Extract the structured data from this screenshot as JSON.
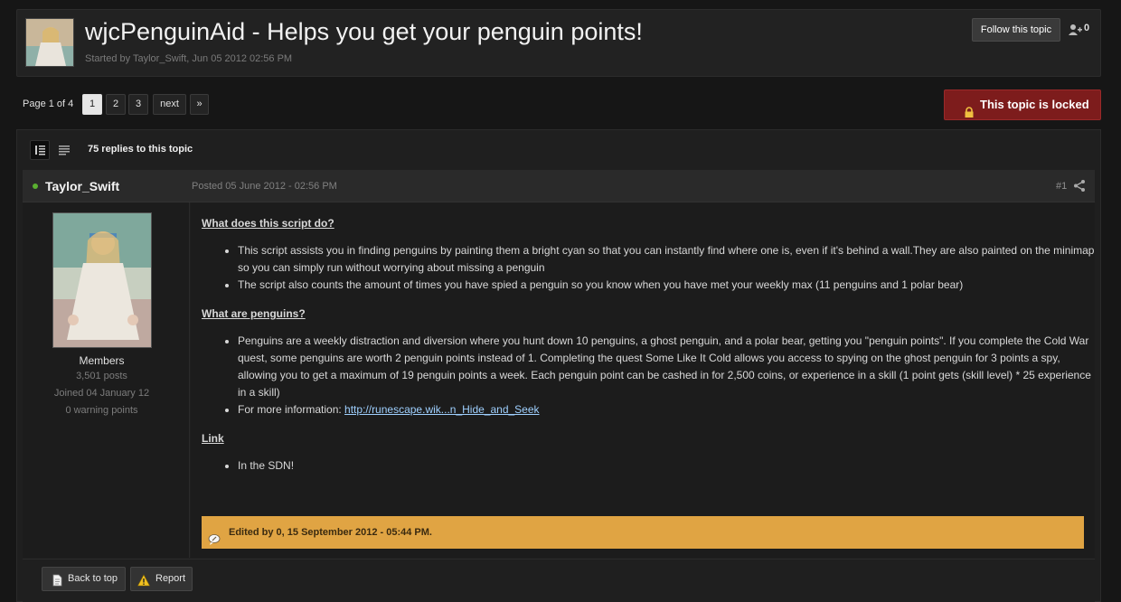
{
  "topic": {
    "title": "wjcPenguinAid - Helps you get your penguin points!",
    "started_by": "Started by Taylor_Swift, Jun 05 2012 02:56 PM",
    "follow_label": "Follow this topic",
    "follower_count": "0"
  },
  "pagination": {
    "page_of": "Page 1 of 4",
    "pages": [
      "1",
      "2",
      "3"
    ],
    "next_label": "next",
    "last_label": "»"
  },
  "locked_label": "This topic is locked",
  "replies_label": "75 replies to this topic",
  "post": {
    "author": "Taylor_Swift",
    "posted": "Posted 05 June 2012 - 02:56 PM",
    "number": "#1",
    "group": "Members",
    "posts": "3,501 posts",
    "joined": "Joined 04 January 12",
    "warnings": "0 warning points",
    "sections": [
      {
        "heading": "What does this script do?",
        "bullets": [
          "This script assists you in finding penguins by painting them a bright cyan so that you can instantly find where one is, even if it's behind a wall.They are also painted on the minimap so you can simply run without worrying about missing a penguin",
          "The script also counts the amount of times you have spied a penguin so you know when you have met your weekly max (11 penguins and 1 polar bear)"
        ]
      },
      {
        "heading": "What are penguins?",
        "bullets": [
          "Penguins are a weekly distraction and diversion where you hunt down 10 penguins, a ghost penguin, and a polar bear, getting you \"penguin points\". If you complete the Cold War quest, some penguins are worth 2 penguin points instead of 1. Completing the quest Some Like It Cold allows you access to spying on the ghost penguin for 3 points a spy, allowing you to get a maximum of 19 penguin points a week. Each penguin point can be cashed in for 2,500 coins, or experience in a skill (1 point gets (skill level) * 25 experience in a skill)"
        ],
        "more_info_label": "For more information: ",
        "more_info_link": "http://runescape.wik...n_Hide_and_Seek"
      },
      {
        "heading": "Link",
        "bullets": [
          "In the SDN!"
        ]
      }
    ],
    "edited": "Edited by 0, 15 September 2012 - 05:44 PM."
  },
  "footer": {
    "back_to_top": "Back to top",
    "report": "Report"
  }
}
